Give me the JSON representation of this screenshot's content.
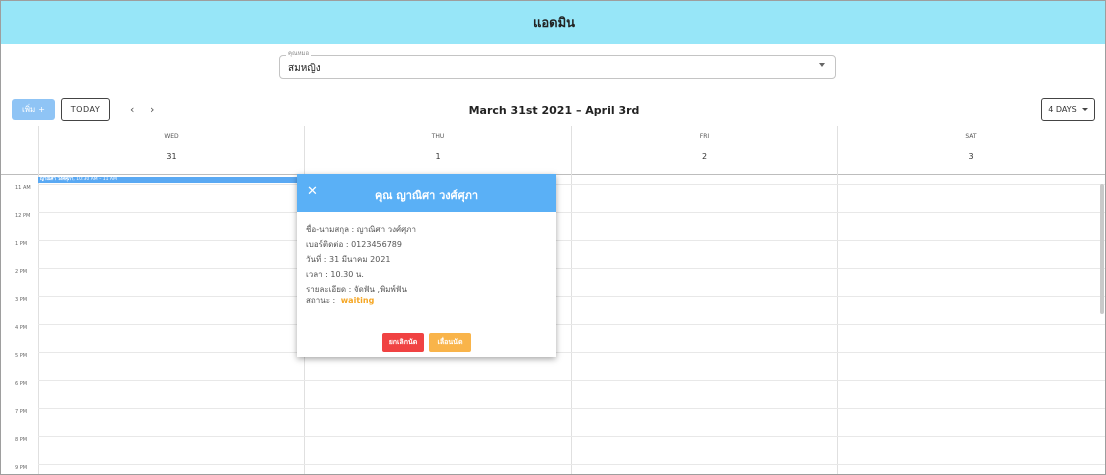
{
  "header": {
    "title": "แอดมิน"
  },
  "filter": {
    "legend": "คุณหมอ",
    "selected": "สมหญิง"
  },
  "toolbar": {
    "add_label": "เพิ่ม",
    "add_icon": "plus-icon",
    "today_label": "TODAY",
    "prev_icon": "‹",
    "next_icon": "›",
    "range_title": "March 31st 2021 – April 3rd",
    "view_label": "4 DAYS"
  },
  "days": [
    {
      "dow": "WED",
      "num": "31"
    },
    {
      "dow": "THU",
      "num": "1"
    },
    {
      "dow": "FRI",
      "num": "2"
    },
    {
      "dow": "SAT",
      "num": "3"
    }
  ],
  "hours": [
    "11 AM",
    "12 PM",
    "1 PM",
    "2 PM",
    "3 PM",
    "4 PM",
    "5 PM",
    "6 PM",
    "7 PM",
    "8 PM",
    "9 PM"
  ],
  "event": {
    "name": "ญาณิศา วงศ์ศุภา",
    "time": "10:30 AM – 11 AM",
    "color": "#5aa9f3"
  },
  "popup": {
    "title": "คุณ ญาณิศา วงศ์ศุภา",
    "close_icon": "✕",
    "lines": [
      "ชื่อ-นามสกุล : ญาณิศา วงศ์ศุภา",
      "เบอร์ติดต่อ : 0123456789",
      "วันที่ : 31 มีนาคม 2021",
      "เวลา : 10.30 น.",
      "รายละเอียด : จัดฟัน ,พิมพ์ฟัน"
    ],
    "status_label": "สถานะ :",
    "status_value": "waiting",
    "cancel_label": "ยกเลิกนัด",
    "postpone_label": "เลื่อนนัด"
  },
  "colors": {
    "topbar": "#97e6f8",
    "primary": "#5ab0f6",
    "cancel": "#f04242",
    "postpone": "#f9b44a",
    "status": "#f5a623"
  }
}
